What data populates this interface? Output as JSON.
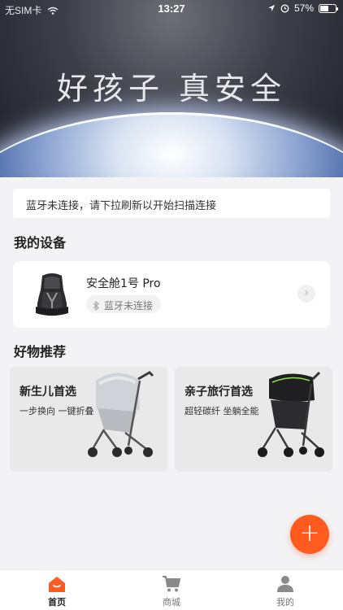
{
  "status_bar": {
    "carrier": "无SIM卡",
    "time": "13:27",
    "battery": "57%",
    "battery_level": 0.57,
    "icons": [
      "wifi-icon",
      "location-arrow-icon",
      "alarm-icon",
      "battery-icon"
    ]
  },
  "hero": {
    "title": "好孩子 真安全"
  },
  "bluetooth_notice": "蓝牙未连接，请下拉刷新以开始扫描连接",
  "devices_section": {
    "title": "我的设备",
    "devices": [
      {
        "name": "安全舱1号 Pro",
        "status": "蓝牙未连接",
        "icon": "car-seat-image"
      }
    ]
  },
  "recommend_section": {
    "title": "好物推荐",
    "products": [
      {
        "title": "新生儿首选",
        "subtitle": "一步换向 一键折叠",
        "icon": "stroller-light-image"
      },
      {
        "title": "亲子旅行首选",
        "subtitle": "超轻碳纤 坐躺全能",
        "icon": "stroller-dark-image"
      }
    ]
  },
  "fab": {
    "label": "+"
  },
  "tabbar": {
    "items": [
      {
        "label": "首页",
        "icon": "home-icon",
        "active": true
      },
      {
        "label": "商城",
        "icon": "cart-icon",
        "active": false
      },
      {
        "label": "我的",
        "icon": "profile-icon",
        "active": false
      }
    ]
  },
  "colors": {
    "accent": "#ff5a1f",
    "background": "#f3f3f5"
  }
}
